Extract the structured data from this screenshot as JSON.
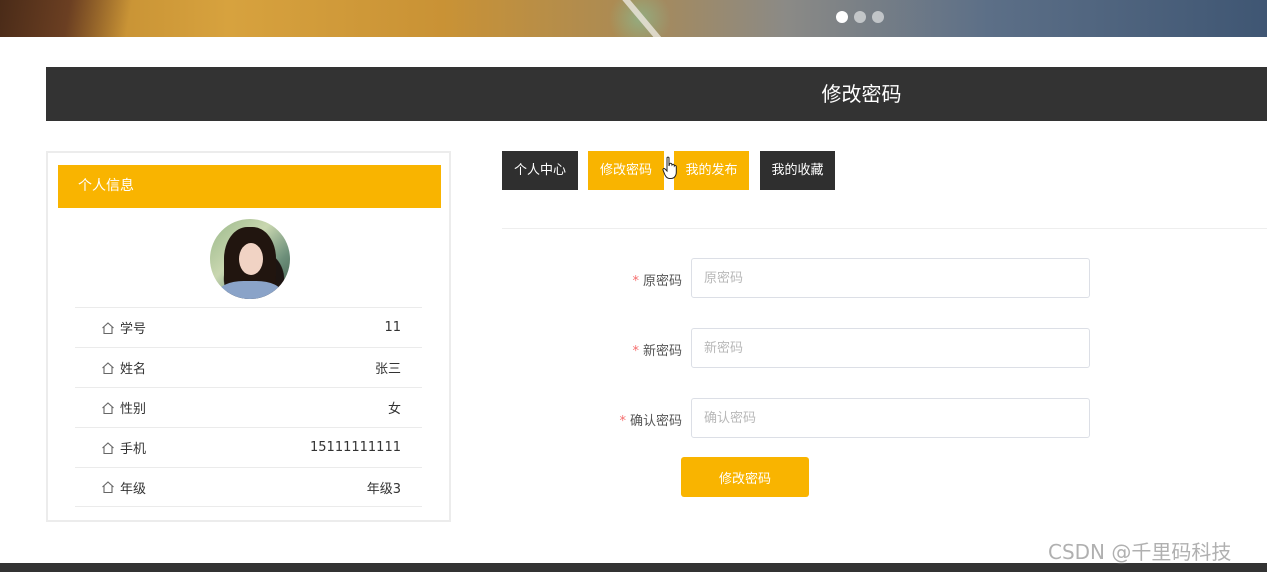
{
  "banner": {
    "slide_count": 3,
    "active_slide": 1
  },
  "page": {
    "title": "修改密码"
  },
  "profile": {
    "header": "个人信息",
    "fields": [
      {
        "label": "学号",
        "value": "11"
      },
      {
        "label": "姓名",
        "value": "张三"
      },
      {
        "label": "性别",
        "value": "女"
      },
      {
        "label": "手机",
        "value": "15111111111"
      },
      {
        "label": "年级",
        "value": "年级3"
      }
    ]
  },
  "tabs": [
    {
      "label": "个人中心",
      "active": false
    },
    {
      "label": "修改密码",
      "active": true
    },
    {
      "label": "我的发布",
      "active": true
    },
    {
      "label": "我的收藏",
      "active": false
    }
  ],
  "form": {
    "required_mark": "*",
    "old_password": {
      "label": "原密码",
      "placeholder": "原密码",
      "value": ""
    },
    "new_password": {
      "label": "新密码",
      "placeholder": "新密码",
      "value": ""
    },
    "confirm_password": {
      "label": "确认密码",
      "placeholder": "确认密码",
      "value": ""
    },
    "submit_label": "修改密码"
  },
  "watermark": "CSDN @千里码科技",
  "colors": {
    "accent": "#f9b400",
    "dark": "#333333",
    "required": "#f56c6c"
  }
}
